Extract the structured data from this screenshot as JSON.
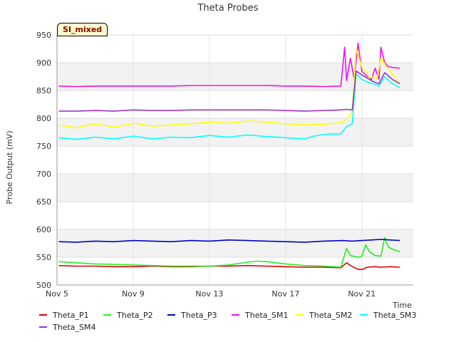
{
  "chart_data": {
    "type": "line",
    "title": "Theta Probes",
    "xlabel": "Time",
    "ylabel": "Probe Output (mV)",
    "badge": "SI_mixed",
    "ylim": [
      500,
      950
    ],
    "yticks": [
      500,
      550,
      600,
      650,
      700,
      750,
      800,
      850,
      900,
      950
    ],
    "xlim": [
      5.0,
      23.7
    ],
    "xticks": [
      {
        "x": 5,
        "label": "Nov 5"
      },
      {
        "x": 9,
        "label": "Nov 9"
      },
      {
        "x": 13,
        "label": "Nov 13"
      },
      {
        "x": 17,
        "label": "Nov 17"
      },
      {
        "x": 21,
        "label": "Nov 21"
      }
    ],
    "colors": {
      "Theta_P1": "#dd0000",
      "Theta_P2": "#22ee22",
      "Theta_P3": "#0000cc",
      "Theta_SM1": "#ee11ee",
      "Theta_SM2": "#ffff00",
      "Theta_SM3": "#00ffff",
      "Theta_SM4": "#9933cc"
    },
    "series": [
      {
        "name": "Theta_P1",
        "x": [
          5.1,
          6,
          7,
          8,
          9,
          10,
          11,
          12,
          13,
          14,
          15,
          16,
          17,
          18,
          19,
          19.9,
          20.2,
          20.4,
          20.8,
          21,
          21.3,
          21.7,
          22,
          22.5,
          23
        ],
        "values": [
          535,
          534,
          534,
          533,
          533,
          534,
          533,
          533,
          534,
          534,
          535,
          534,
          533,
          532,
          532,
          531,
          540,
          535,
          528,
          528,
          532,
          533,
          532,
          533,
          532
        ]
      },
      {
        "name": "Theta_P2",
        "x": [
          5.1,
          6,
          7,
          8,
          9,
          10,
          11,
          12,
          13,
          14,
          15,
          15.5,
          16,
          17,
          18,
          19,
          19.9,
          20.2,
          20.4,
          20.8,
          21,
          21.2,
          21.4,
          21.7,
          22,
          22.2,
          22.4,
          22.7,
          23
        ],
        "values": [
          542,
          540,
          538,
          537,
          536,
          535,
          534,
          534,
          534,
          536,
          541,
          543,
          542,
          538,
          535,
          534,
          532,
          566,
          553,
          550,
          552,
          572,
          560,
          553,
          552,
          585,
          568,
          563,
          560
        ]
      },
      {
        "name": "Theta_P3",
        "x": [
          5.1,
          6,
          7,
          8,
          9,
          10,
          11,
          12,
          13,
          14,
          15,
          16,
          17,
          18,
          19,
          20,
          20.5,
          21,
          21.5,
          22,
          22.5,
          23
        ],
        "values": [
          578,
          577,
          579,
          578,
          580,
          579,
          578,
          580,
          579,
          581,
          580,
          579,
          578,
          577,
          579,
          580,
          579,
          580,
          581,
          582,
          581,
          580
        ]
      },
      {
        "name": "Theta_SM1",
        "x": [
          5.1,
          6,
          7,
          8,
          9,
          10,
          11,
          12,
          13,
          14,
          15,
          16,
          17,
          18,
          19,
          19.9,
          20.1,
          20.2,
          20.4,
          20.6,
          20.8,
          21,
          21.2,
          21.5,
          21.7,
          21.9,
          22,
          22.2,
          22.4,
          22.7,
          23
        ],
        "values": [
          858,
          857,
          858,
          858,
          858,
          858,
          858,
          859,
          859,
          859,
          859,
          859,
          858,
          858,
          857,
          858,
          928,
          868,
          908,
          870,
          935,
          885,
          878,
          870,
          890,
          870,
          928,
          900,
          893,
          891,
          890
        ]
      },
      {
        "name": "Theta_SM2",
        "x": [
          5.1,
          6,
          7,
          8,
          9,
          10,
          11,
          12,
          13,
          14,
          15,
          16,
          17,
          18,
          19,
          19.9,
          20.2,
          20.5,
          20.7,
          21,
          21.2,
          21.4,
          21.6,
          21.8,
          22,
          22.3,
          22.6,
          23
        ],
        "values": [
          788,
          783,
          790,
          784,
          791,
          786,
          788,
          790,
          793,
          791,
          795,
          793,
          790,
          788,
          789,
          792,
          798,
          812,
          925,
          892,
          885,
          872,
          875,
          870,
          908,
          893,
          880,
          860
        ]
      },
      {
        "name": "Theta_SM3",
        "x": [
          5.1,
          6,
          7,
          8,
          9,
          10,
          11,
          12,
          13,
          14,
          15,
          16,
          17,
          18,
          18.5,
          19,
          19.9,
          20.2,
          20.5,
          20.7,
          21,
          21.3,
          21.6,
          21.9,
          22.2,
          22.6,
          23
        ],
        "values": [
          765,
          762,
          766,
          763,
          768,
          763,
          766,
          765,
          769,
          766,
          770,
          767,
          765,
          763,
          768,
          771,
          772,
          785,
          790,
          880,
          870,
          865,
          862,
          858,
          875,
          862,
          855
        ]
      },
      {
        "name": "Theta_SM4",
        "x": [
          5.1,
          6,
          7,
          8,
          9,
          10,
          11,
          12,
          13,
          14,
          15,
          16,
          17,
          18,
          19,
          19.9,
          20.2,
          20.5,
          20.7,
          21,
          21.3,
          21.6,
          21.9,
          22.2,
          22.6,
          23
        ],
        "values": [
          813,
          813,
          814,
          813,
          815,
          814,
          814,
          815,
          815,
          815,
          815,
          815,
          814,
          813,
          814,
          815,
          816,
          815,
          885,
          878,
          872,
          866,
          862,
          882,
          870,
          862
        ]
      }
    ]
  }
}
